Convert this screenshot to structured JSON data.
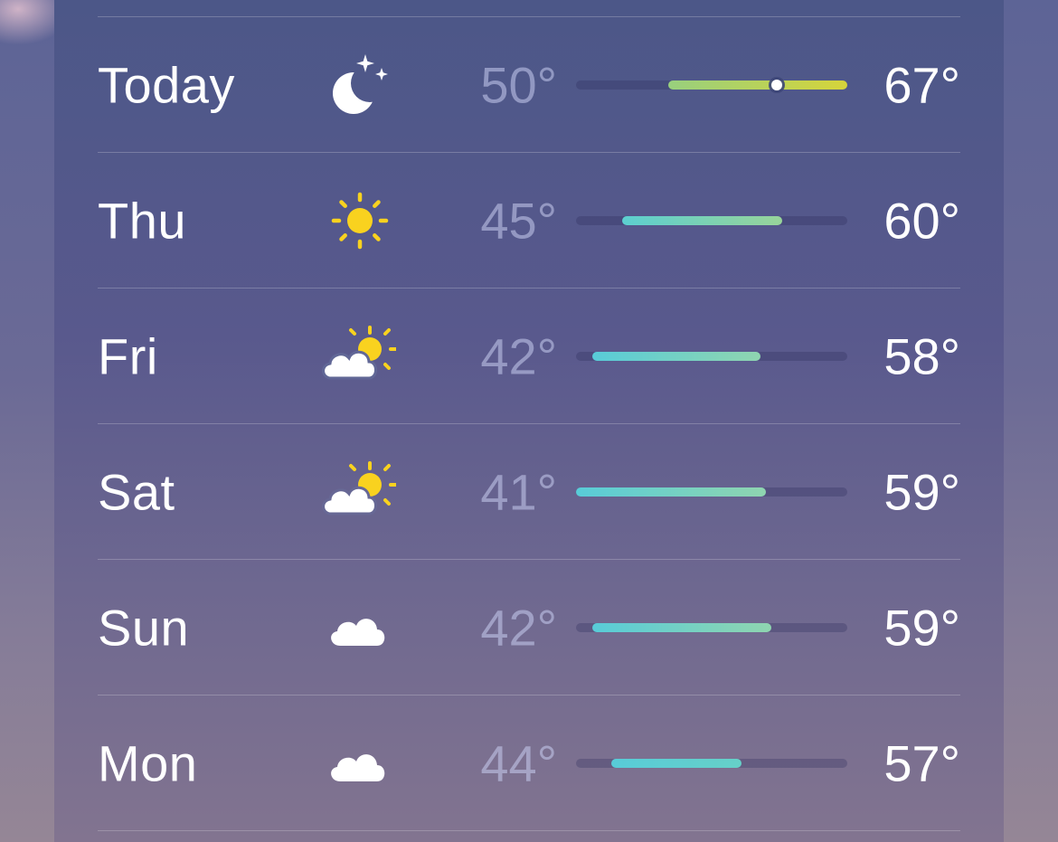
{
  "daily_forecast": {
    "rows": [
      {
        "day": "Today",
        "icon": "moon-stars-icon",
        "low": "50°",
        "high": "67°",
        "bar": {
          "start": 0.34,
          "end": 1.0,
          "current": 0.74
        },
        "colors": [
          "#98d07e",
          "#d6d43a"
        ]
      },
      {
        "day": "Thu",
        "icon": "sun-icon",
        "low": "45°",
        "high": "60°",
        "bar": {
          "start": 0.17,
          "end": 0.76
        },
        "colors": [
          "#5ccfd0",
          "#98d49a"
        ]
      },
      {
        "day": "Fri",
        "icon": "partly-cloudy-icon",
        "low": "42°",
        "high": "58°",
        "bar": {
          "start": 0.06,
          "end": 0.68
        },
        "colors": [
          "#58ccd8",
          "#8fd5b0"
        ]
      },
      {
        "day": "Sat",
        "icon": "partly-cloudy-icon",
        "low": "41°",
        "high": "59°",
        "bar": {
          "start": 0.0,
          "end": 0.7
        },
        "colors": [
          "#58ccd8",
          "#8fd5b0"
        ]
      },
      {
        "day": "Sun",
        "icon": "cloud-icon",
        "low": "42°",
        "high": "59°",
        "bar": {
          "start": 0.06,
          "end": 0.72
        },
        "colors": [
          "#58ccd8",
          "#8fd5b0"
        ]
      },
      {
        "day": "Mon",
        "icon": "cloud-icon",
        "low": "44°",
        "high": "57°",
        "bar": {
          "start": 0.13,
          "end": 0.61
        },
        "colors": [
          "#58ccd8",
          "#66d0c8"
        ]
      }
    ]
  }
}
